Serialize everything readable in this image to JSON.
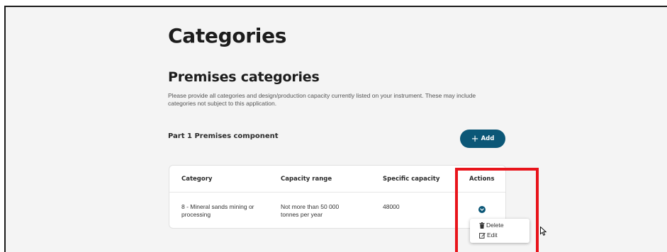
{
  "page": {
    "title": "Categories"
  },
  "section": {
    "title": "Premises categories",
    "description": "Please provide all categories and design/production capacity currently listed on your instrument. These may include categories not subject to this application."
  },
  "component": {
    "label": "Part 1 Premises component",
    "add_button": {
      "icon": "+",
      "label": "Add"
    }
  },
  "table": {
    "headers": [
      "Category",
      "Capacity range",
      "Specific capacity",
      "Actions"
    ],
    "rows": [
      [
        "8 - Mineral sands mining or processing",
        "Not more than 50 000 tonnes per year",
        "48000"
      ]
    ]
  },
  "actions_menu": {
    "items": [
      {
        "icon": "trash-icon",
        "label": "Delete"
      },
      {
        "icon": "edit-icon",
        "label": "Edit"
      }
    ]
  },
  "colors": {
    "accent": "#0b5777",
    "highlight": "#e8141b",
    "page_background": "#f4f4f4"
  }
}
